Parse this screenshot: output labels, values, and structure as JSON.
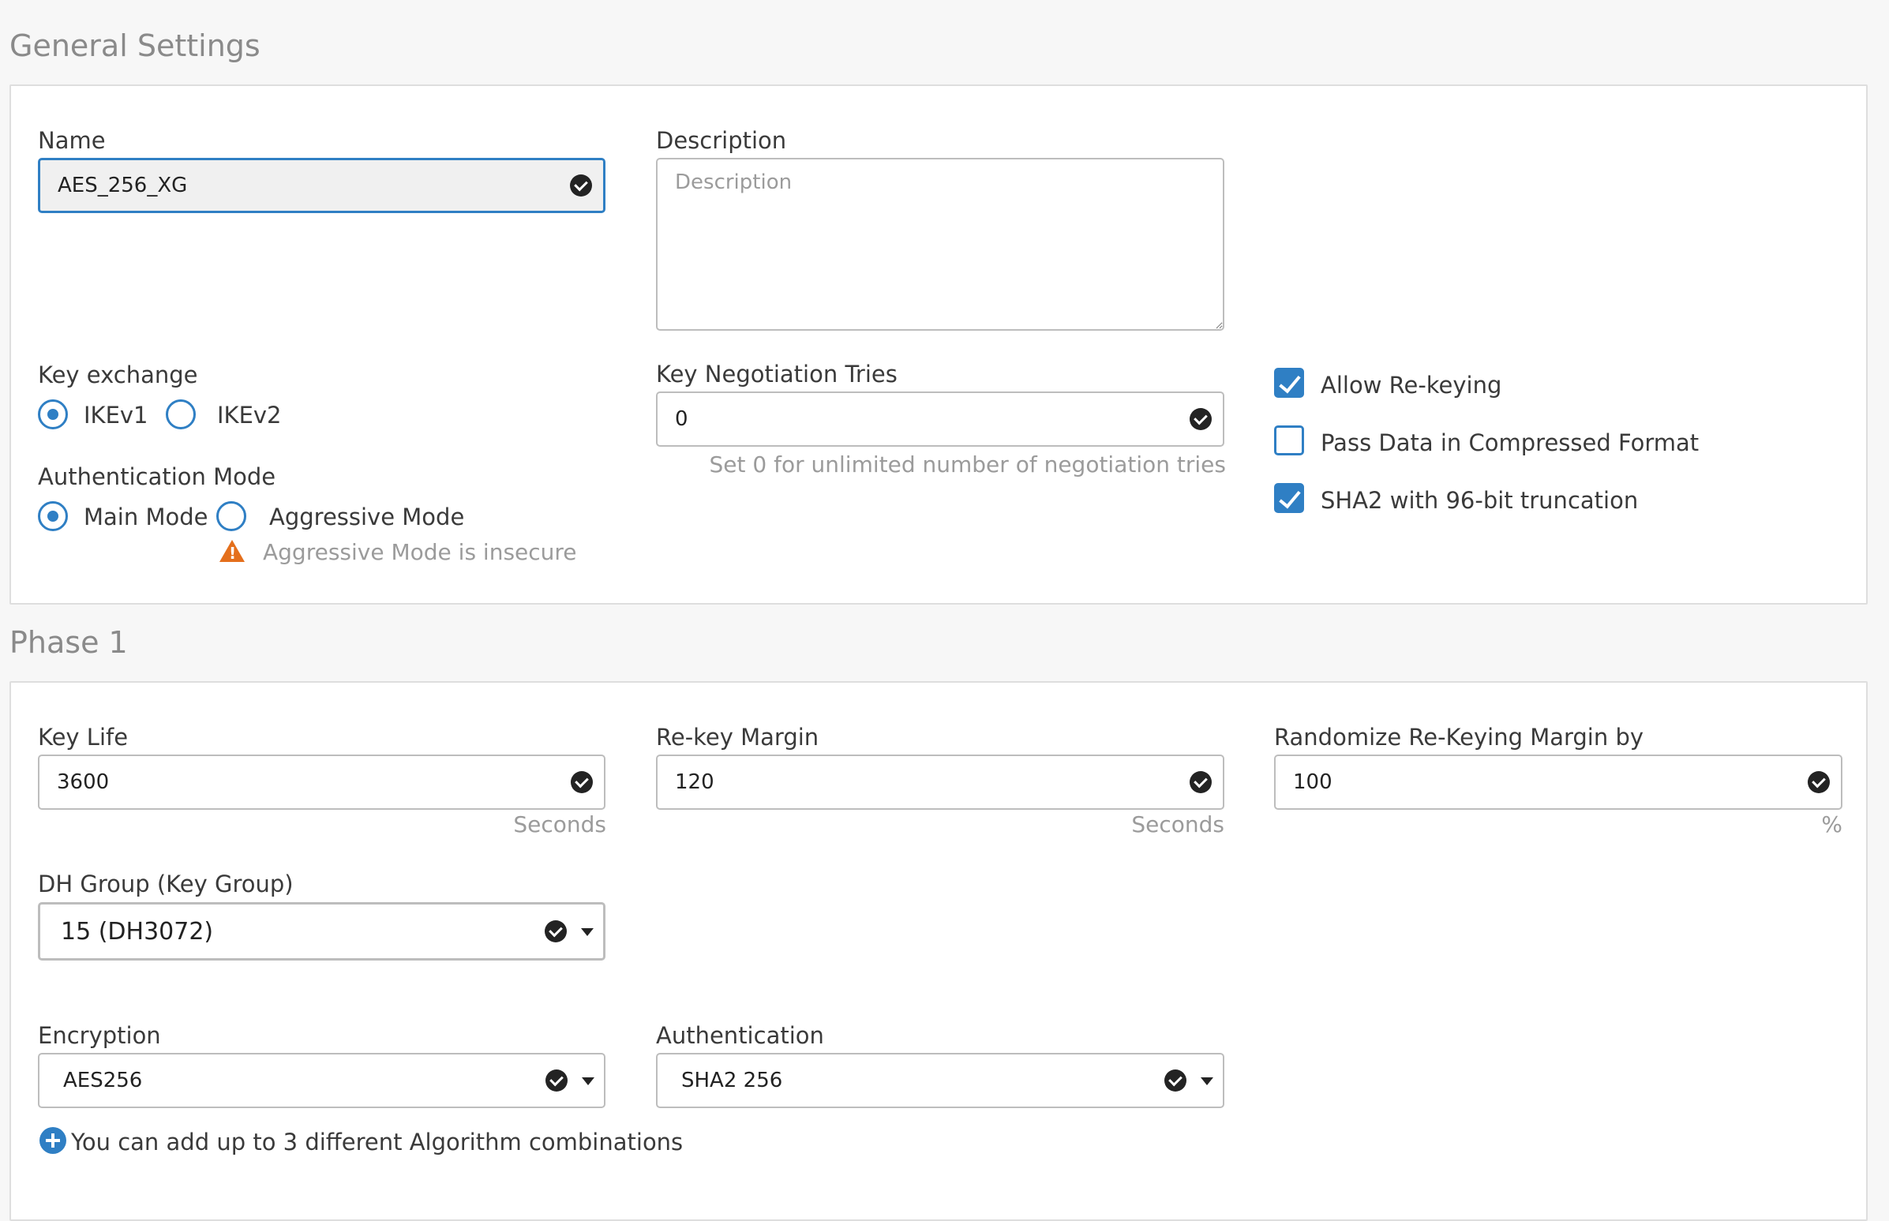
{
  "general": {
    "title": "General Settings",
    "name": {
      "label": "Name",
      "value": "AES_256_XG"
    },
    "description": {
      "label": "Description",
      "placeholder": "Description"
    },
    "key_exchange": {
      "label": "Key exchange",
      "options": [
        {
          "label": "IKEv1",
          "selected": true
        },
        {
          "label": "IKEv2",
          "selected": false
        }
      ]
    },
    "auth_mode": {
      "label": "Authentication Mode",
      "options": [
        {
          "label": "Main Mode",
          "selected": true
        },
        {
          "label": "Aggressive Mode",
          "selected": false
        }
      ],
      "warning": "Aggressive Mode is insecure"
    },
    "key_negotiation": {
      "label": "Key Negotiation Tries",
      "value": "0",
      "hint": "Set 0 for unlimited number of negotiation tries"
    },
    "checkboxes": [
      {
        "label": "Allow Re-keying",
        "checked": true
      },
      {
        "label": "Pass Data in Compressed Format",
        "checked": false
      },
      {
        "label": "SHA2 with 96-bit truncation",
        "checked": true
      }
    ]
  },
  "phase1": {
    "title": "Phase 1",
    "key_life": {
      "label": "Key Life",
      "value": "3600",
      "unit": "Seconds"
    },
    "rekey_margin": {
      "label": "Re-key Margin",
      "value": "120",
      "unit": "Seconds"
    },
    "randomize": {
      "label": "Randomize Re-Keying Margin by",
      "value": "100",
      "unit": "%"
    },
    "dh_group": {
      "label": "DH Group (Key Group)",
      "value": "15 (DH3072)"
    },
    "encryption": {
      "label": "Encryption",
      "value": "AES256"
    },
    "authentication": {
      "label": "Authentication",
      "value": "SHA2 256"
    },
    "add_combo_text": "You can add up to 3 different Algorithm combinations"
  },
  "colors": {
    "accent": "#2f7fc4",
    "warning": "#e46f1c"
  }
}
